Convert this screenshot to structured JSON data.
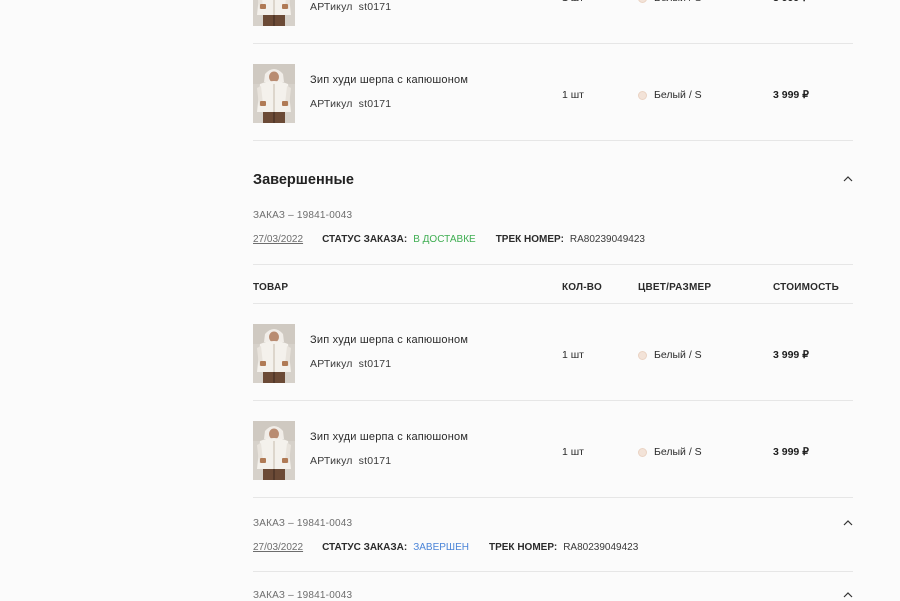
{
  "product": {
    "name": "Зип худи шерпа с капюшоном",
    "article_label": "АРТикул",
    "article": "st0171",
    "qty": "1 шт",
    "color_size": "Белый / S",
    "price": "3 999 ₽",
    "swatch_color": "#f3e3d8"
  },
  "completed": {
    "title": "Завершенные"
  },
  "table": {
    "col_product": "Товар",
    "col_qty": "Кол-во",
    "col_color_size": "Цвет/Размер",
    "col_price": "Стоимость"
  },
  "orders": [
    {
      "id": "ЗАКАЗ – 19841-0043",
      "date": "27/03/2022",
      "status_label": "СТАТУС ЗАКАЗА:",
      "status": "В ДОСТАВКЕ",
      "status_color": "#3fae52",
      "track_label": "ТРЕК НОМЕР:",
      "track": "RA80239049423"
    },
    {
      "id": "ЗАКАЗ – 19841-0043",
      "date": "27/03/2022",
      "status_label": "СТАТУС ЗАКАЗА:",
      "status": "ЗАВЕРШЕН",
      "status_color": "#4a84d8",
      "track_label": "ТРЕК НОМЕР:",
      "track": "RA80239049423"
    },
    {
      "id": "ЗАКАЗ – 19841-0043"
    }
  ]
}
